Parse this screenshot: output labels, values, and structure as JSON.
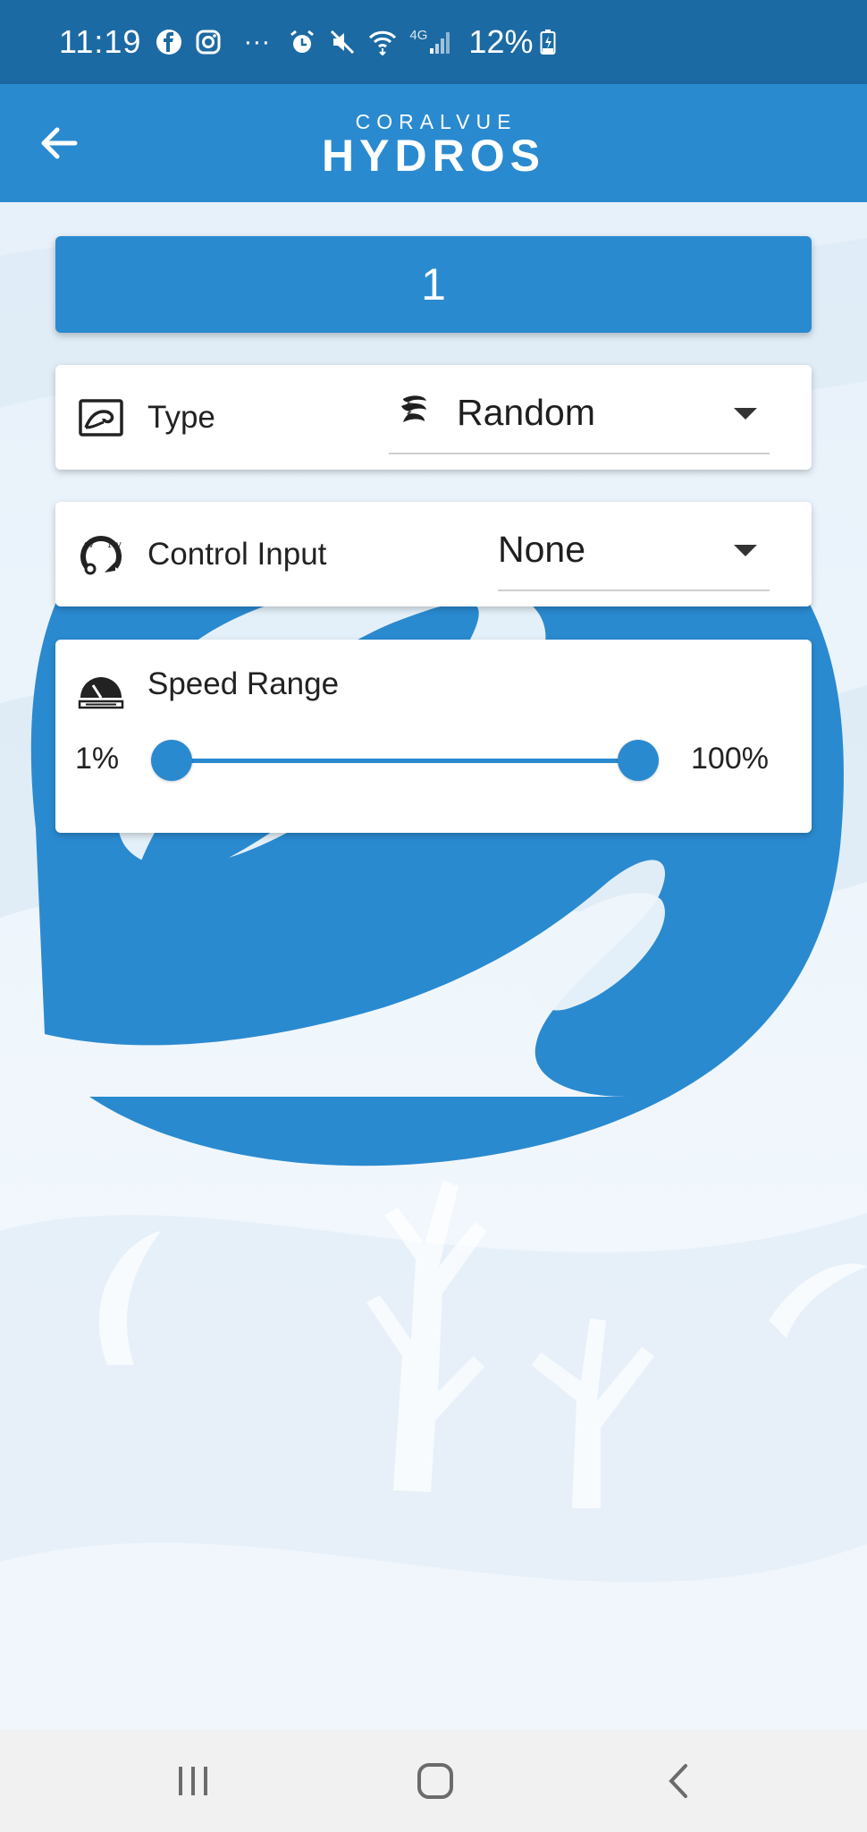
{
  "status_bar": {
    "time": "11:19",
    "ellipsis": "···",
    "network": "4G",
    "battery": "12%",
    "icons": [
      "facebook-icon",
      "instagram-icon",
      "alarm-icon",
      "mute-icon",
      "wifi-icon",
      "signal-icon",
      "battery-charging-icon"
    ]
  },
  "app_bar": {
    "logo_top": "CORALVUE",
    "logo_main": "HYDROS",
    "back_icon": "arrow-left-icon"
  },
  "header": {
    "title": "1"
  },
  "type_row": {
    "icon": "wave-box-icon",
    "label": "Type",
    "value_icon": "random-flow-icon",
    "value": "Random"
  },
  "control_row": {
    "icon": "control-input-gauge-icon",
    "label": "Control Input",
    "value": "None"
  },
  "speed_row": {
    "icon": "speedometer-icon",
    "label": "Speed Range",
    "min_label": "1%",
    "max_label": "100%",
    "min_value": 1,
    "max_value": 100
  },
  "nav_bar": {
    "icons": [
      "recent-apps-icon",
      "home-icon",
      "back-icon"
    ]
  },
  "colors": {
    "primary": "#2a8ad0",
    "status_bar": "#1c6aa3"
  }
}
